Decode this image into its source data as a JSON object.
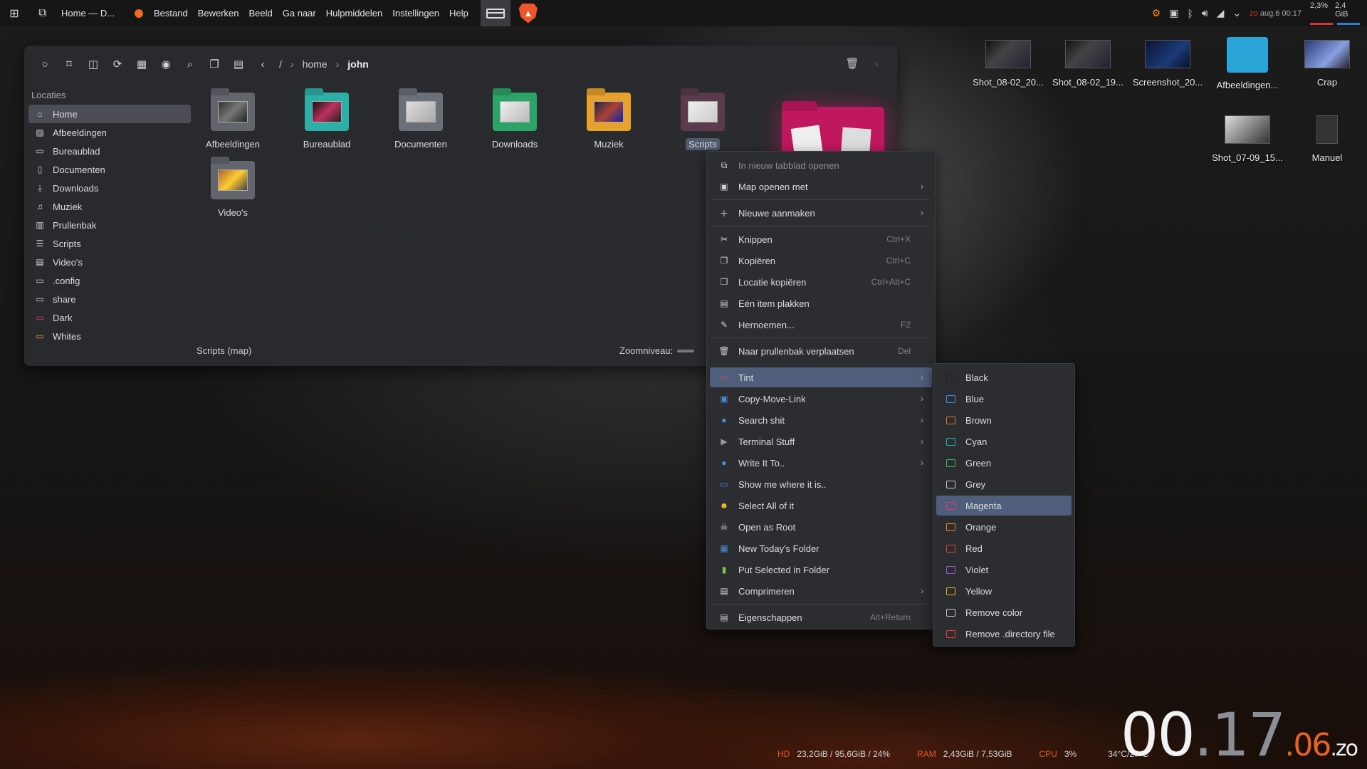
{
  "topbar": {
    "window_title": "Home — D...",
    "menu": [
      "Bestand",
      "Bewerken",
      "Beeld",
      "Ga naar",
      "Hulpmiddelen",
      "Instellingen",
      "Help"
    ],
    "tray_datetime": "aug.6 00:17",
    "tray_day": "zo",
    "cpu_mini": "2,3%",
    "mem_mini": "2,4 GiB"
  },
  "filemanager": {
    "breadcrumb": [
      "/",
      "home",
      "john"
    ],
    "sidebar_title": "Locaties",
    "sidebar": [
      "Home",
      "Afbeeldingen",
      "Bureaublad",
      "Documenten",
      "Downloads",
      "Muziek",
      "Prullenbak",
      "Scripts",
      "Video's",
      ".config",
      "share",
      "Dark",
      "Whites"
    ],
    "folders": [
      "Afbeeldingen",
      "Bureaublad",
      "Documenten",
      "Downloads",
      "Muziek",
      "Scripts",
      "Video's"
    ],
    "status": "Scripts (map)",
    "zoom_label": "Zoomniveau:"
  },
  "context_menu": {
    "items": [
      {
        "label": "In nieuw tabblad openen",
        "shortcut": ""
      },
      {
        "label": "Map openen met",
        "shortcut": ""
      },
      {
        "label": "Nieuwe aanmaken",
        "shortcut": ""
      },
      {
        "label": "Knippen",
        "shortcut": "Ctrl+X"
      },
      {
        "label": "Kopiëren",
        "shortcut": "Ctrl+C"
      },
      {
        "label": "Locatie kopiëren",
        "shortcut": "Ctrl+Alt+C"
      },
      {
        "label": "Eén item plakken",
        "shortcut": ""
      },
      {
        "label": "Hernoemen...",
        "shortcut": "F2"
      },
      {
        "label": "Naar prullenbak verplaatsen",
        "shortcut": "Del"
      },
      {
        "label": "Tint",
        "shortcut": ""
      },
      {
        "label": "Copy-Move-Link",
        "shortcut": ""
      },
      {
        "label": "Search shit",
        "shortcut": ""
      },
      {
        "label": "Terminal Stuff",
        "shortcut": ""
      },
      {
        "label": "Write It To..",
        "shortcut": ""
      },
      {
        "label": "Show me where it is..",
        "shortcut": ""
      },
      {
        "label": "Select All of it",
        "shortcut": ""
      },
      {
        "label": "Open as Root",
        "shortcut": ""
      },
      {
        "label": "New Today's Folder",
        "shortcut": ""
      },
      {
        "label": "Put Selected in Folder",
        "shortcut": ""
      },
      {
        "label": "Comprimeren",
        "shortcut": ""
      },
      {
        "label": "Eigenschappen",
        "shortcut": "Alt+Return"
      }
    ]
  },
  "tint_submenu": {
    "items": [
      {
        "label": "Black",
        "color": "#222222"
      },
      {
        "label": "Blue",
        "color": "#3d8fe0"
      },
      {
        "label": "Brown",
        "color": "#d07a2a"
      },
      {
        "label": "Cyan",
        "color": "#22b5b5"
      },
      {
        "label": "Green",
        "color": "#3bbf5a"
      },
      {
        "label": "Grey",
        "color": "#c8c8c8"
      },
      {
        "label": "Magenta",
        "color": "#d63e86"
      },
      {
        "label": "Orange",
        "color": "#f08a1c"
      },
      {
        "label": "Red",
        "color": "#e04040"
      },
      {
        "label": "Violet",
        "color": "#a058d8"
      },
      {
        "label": "Yellow",
        "color": "#f0b428"
      },
      {
        "label": "Remove color",
        "color": "#c8c8c8"
      },
      {
        "label": "Remove .directory file",
        "color": "#e04040"
      }
    ]
  },
  "desktop": {
    "icons": [
      "Shot_08-02_20...",
      "Shot_08-02_19...",
      "Screenshot_20...",
      "Afbeeldingen...",
      "Crap",
      "Shot_07-09_15...",
      "Manuel"
    ]
  },
  "stats": {
    "hd_label": "HD",
    "hd_value": "23,2GiB / 95,6GiB / 24%",
    "ram_label": "RAM",
    "ram_value": "2,43GiB / 7,53GiB",
    "cpu_label": "CPU",
    "cpu_value": "3%",
    "temp": "34°C/27°C"
  },
  "clock": {
    "hours": "00",
    "minutes": ".17",
    "seconds": ".06",
    "day": ".zo"
  }
}
